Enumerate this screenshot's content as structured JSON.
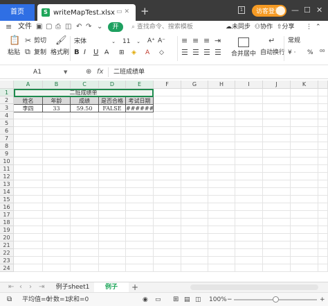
{
  "titlebar": {
    "home_tab": "首页",
    "file_icon": "S",
    "file_name": "writeMapTest.xlsx",
    "new_tab": "+",
    "login": "访客登录",
    "minimize": "—",
    "maximize": "☐",
    "close": "✕"
  },
  "menubar": {
    "menu_icon": "≡",
    "file_label": "文件",
    "start_label": "开",
    "search_placeholder": "查找命令、搜索模板",
    "sync_label": "未同步",
    "collab_label": "协作",
    "share_label": "分享"
  },
  "ribbon": {
    "paste": "粘贴",
    "cut": "剪切",
    "copy": "复制",
    "format_painter": "格式刷",
    "font_name": "宋体",
    "font_size": "11",
    "bold": "B",
    "italic": "I",
    "underline": "U",
    "merge_center": "合并居中",
    "wrap_text": "自动换行",
    "number_format": "常规"
  },
  "formula_bar": {
    "cell_ref": "A1",
    "fx": "fx",
    "content": "二班成绩单"
  },
  "grid": {
    "columns": [
      "A",
      "B",
      "C",
      "D",
      "E",
      "F",
      "G",
      "H",
      "I",
      "J",
      "K"
    ],
    "rows": [
      "1",
      "2",
      "3",
      "4",
      "5",
      "6",
      "7",
      "8",
      "9",
      "10",
      "11",
      "12",
      "13",
      "14",
      "15",
      "16",
      "17",
      "18",
      "19",
      "20",
      "21",
      "22",
      "23",
      "24"
    ],
    "title": "二班成绩单",
    "headers": [
      "姓名",
      "年龄",
      "成绩",
      "是否合格",
      "考试日期"
    ],
    "row3": [
      "李四",
      "33",
      "59.50",
      "FALSE",
      "########"
    ]
  },
  "sheets": {
    "tabs": [
      "例子sheet1",
      "例子sheet2"
    ],
    "active_index": 1,
    "add": "+"
  },
  "status": {
    "average": "平均值=0",
    "count": "计数=1",
    "sum": "求和=0",
    "zoom": "100%",
    "zoom_level": 1.0
  },
  "colors": {
    "accent_green": "#1d8a4d",
    "active_tab": "#1fa65a",
    "home_blue": "#2f6fe4",
    "login_orange": "#f59a23"
  }
}
